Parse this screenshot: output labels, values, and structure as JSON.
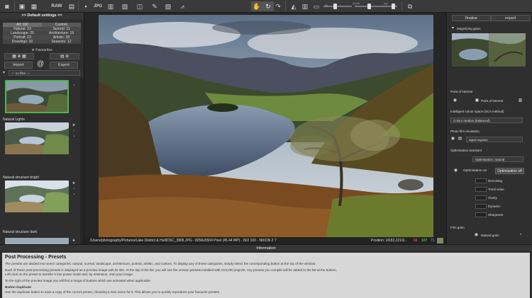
{
  "toolbar": {
    "raw_label": "RAW",
    "jpeg_label": "JPG",
    "zoom_label": "Zoom",
    "zoom_percent_label": "%",
    "vertical_label": "lbr",
    "angle_label": "ngl"
  },
  "left_panel": {
    "title": ">> Default settings <<",
    "categories": [
      {
        "left": "All: 160",
        "right": "Custom"
      },
      {
        "left": "Natural: 23",
        "right": "Surreal: 11"
      },
      {
        "left": "Landscape: 25",
        "right": "Architecture: 19"
      },
      {
        "left": "Portrait: 23",
        "right": "Artistic: 28"
      },
      {
        "left": "Drawings: 18",
        "right": "Seasons: 12"
      }
    ],
    "favourites_label": "Favourites",
    "import_label": "Import",
    "export_label": "Export",
    "filter_placeholder": "— no filter —",
    "presets": [
      {
        "label": ""
      },
      {
        "label": "Natural Lights"
      },
      {
        "label": "Natural structure bright"
      },
      {
        "label": "Natural structure dark"
      }
    ]
  },
  "status": {
    "path": "/Users/photography/Pictures/Lake District & Hull/DSC_3806.JPG - 8256x5504 Pixel (45.44 MP)  -  ISO 100 - NIKON Z 7",
    "position": "Position: (4182,2216) -",
    "r": "66",
    "g": "107",
    "b": "71"
  },
  "right_panel": {
    "tab_finalise": "finalise",
    "tab_expert": "expert",
    "magnifying_glass": "Magnifying glass",
    "point_of_interest_title": "Point of interest",
    "point_of_interest_button": "Point of interest",
    "colour_space_title": "Intelligent colour space (SCA method)",
    "colour_space_value": "Colour median (balanced)",
    "film_emulation_title": "Photo film emulation",
    "film_emulation_value": "digital negative",
    "optimisation_title": "Optimisation assistant",
    "optimisation_value": "Optimisation: natural",
    "optimisation_on": "Optimisation on",
    "optimisation_off": "Optimisation off",
    "options": [
      "Denoising",
      "Tonal value",
      "Clarity",
      "Dynamic",
      "Sharpness"
    ],
    "film_grain_title": "Film grain",
    "natural_grain": "Natural grain"
  },
  "info": {
    "panel_title": "Information",
    "heading": "Post Processing - Presets",
    "p1": "The presets are divided into seven categories: natural, surreal, landscape, architecture, portrait, artistic, and custom. To display any of these categories, simply select the corresponding button at the top of the window.",
    "p2": "Each of these post-processing presets is displayed as a preview image with its title. At the top of the list, you will see the version presets installed with COLOR projects. Any presets you compile will be added to the list at the bottom.",
    "p2b": "Left-click on the preset to transfer it into power mode and, by extension, onto your image.",
    "p3": "To the right of the preview image you will find a range of buttons which are activated when applicable.",
    "button_heading": "Button Duplicate",
    "p4": "Use the duplicate button to save a copy of the current preset, choosing a new name for it. This allows you to quickly reproduce your favourite presets."
  },
  "colors": {
    "selected_border": "#4cb64c",
    "red_value": "#e04040",
    "green_value": "#40c040",
    "blue_value": "#5080ff"
  }
}
